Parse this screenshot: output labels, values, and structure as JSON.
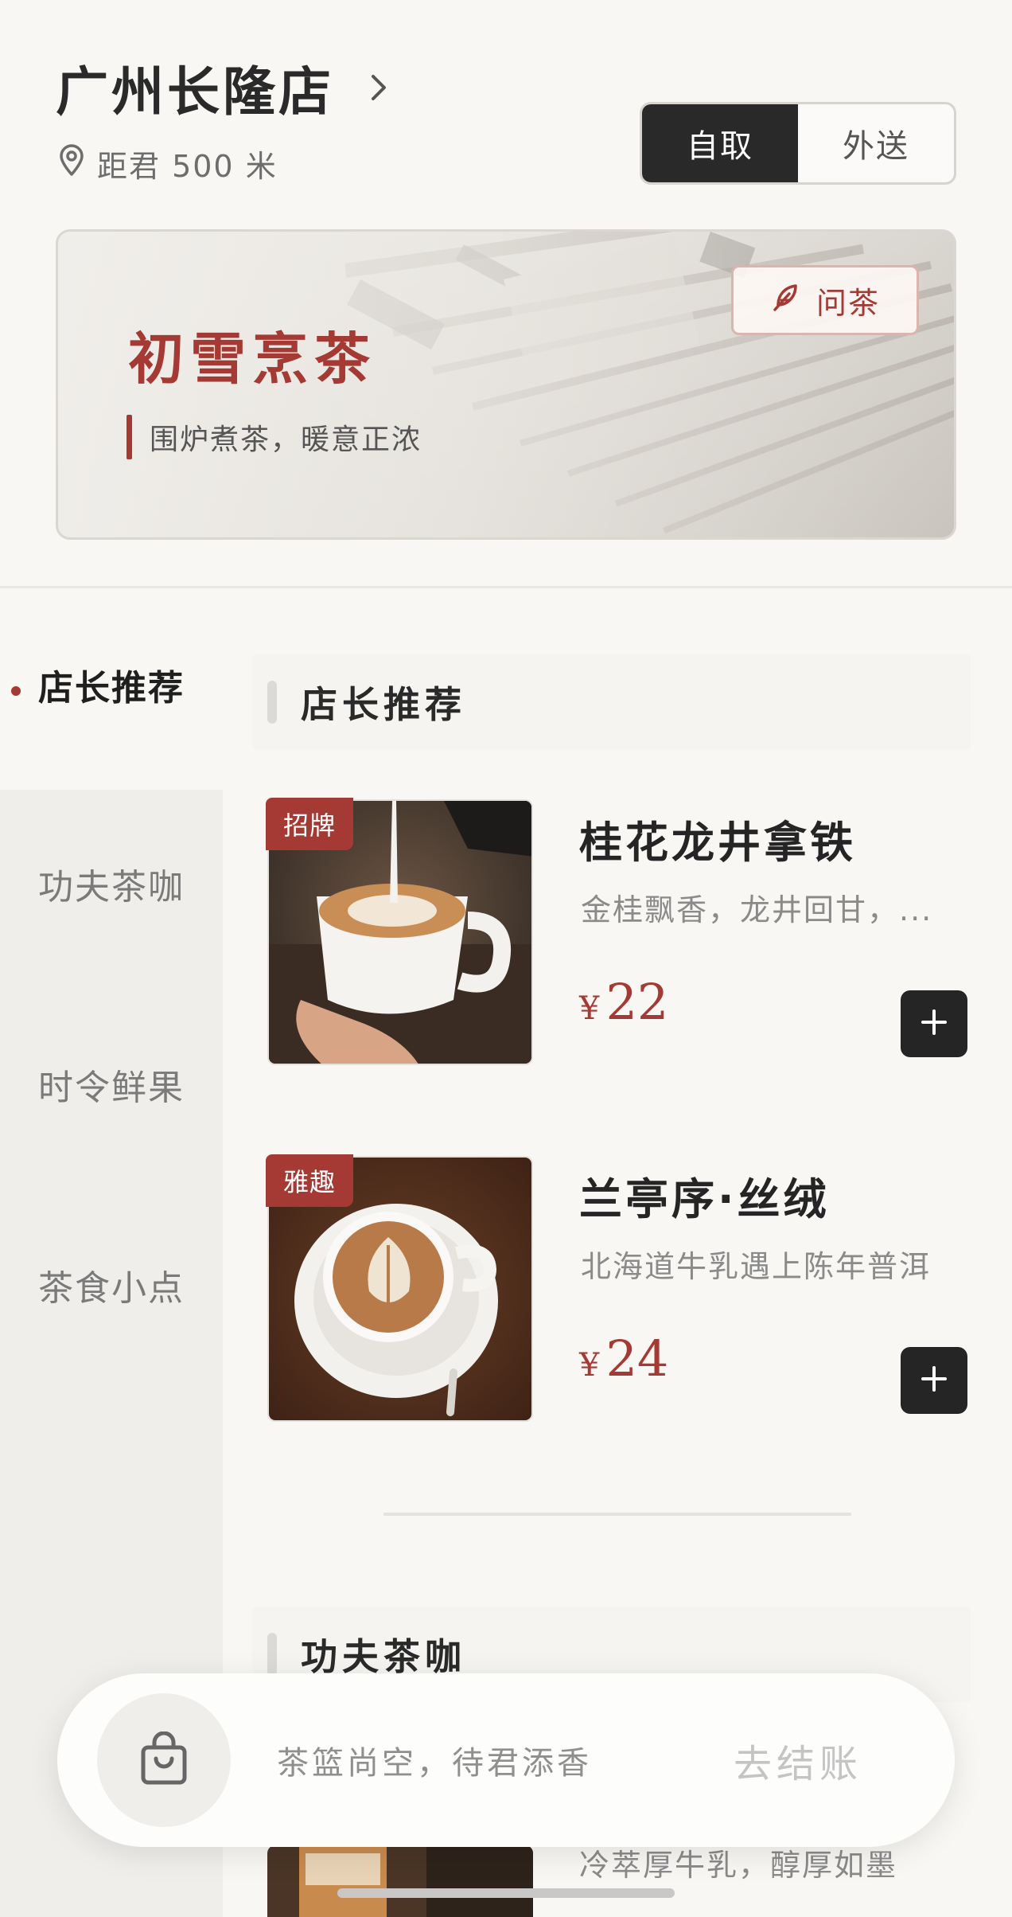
{
  "header": {
    "store_name": "广州长隆店",
    "distance": "距君 500 米",
    "mode_pickup": "自取",
    "mode_delivery": "外送"
  },
  "banner": {
    "title": "初雪烹茶",
    "subtitle": "围炉煮茶，暖意正浓",
    "ask_button": "问茶"
  },
  "sidebar": {
    "items": [
      {
        "label": "店长推荐",
        "active": true
      },
      {
        "label": "功夫茶咖",
        "active": false
      },
      {
        "label": "时令鲜果",
        "active": false
      },
      {
        "label": "茶食小点",
        "active": false
      }
    ]
  },
  "sections": [
    {
      "title": "店长推荐",
      "products": [
        {
          "tag": "招牌",
          "name": "桂花龙井拿铁",
          "desc": "金桂飘香，龙井回甘，...",
          "currency": "¥",
          "price": "22"
        },
        {
          "tag": "雅趣",
          "name": "兰亭序·丝绒",
          "desc": "北海道牛乳遇上陈年普洱",
          "currency": "¥",
          "price": "24"
        }
      ]
    },
    {
      "title": "功夫茶咖",
      "products": [
        {
          "desc": "冷萃厚牛乳，醇厚如墨"
        }
      ]
    }
  ],
  "cart": {
    "empty_text": "茶篮尚空，待君添香",
    "checkout_label": "去结账"
  },
  "colors": {
    "accent": "#a43a33",
    "dark": "#292929",
    "background": "#f8f7f4"
  }
}
